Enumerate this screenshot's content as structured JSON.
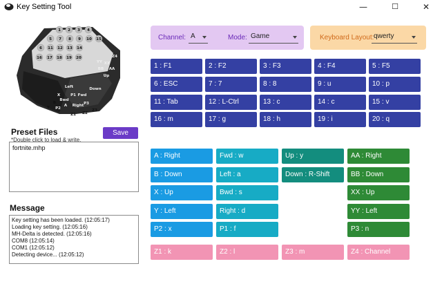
{
  "window": {
    "title": "Key Setting Tool",
    "minimize_glyph": "—",
    "maximize_glyph": "☐",
    "close_glyph": "✕"
  },
  "device": {
    "labels": [
      "1",
      "2",
      "3",
      "4",
      "5",
      "6",
      "7",
      "8",
      "9",
      "10",
      "11",
      "12",
      "13",
      "14",
      "15",
      "16",
      "17",
      "18",
      "19",
      "20",
      "Z4",
      "XX",
      "BB",
      "AA",
      "Up",
      "YY",
      "Left",
      "Down",
      "Fwd",
      "P1",
      "X",
      "Bwd",
      "A",
      "Right",
      "P2",
      "P3",
      "Y",
      "Z1",
      "Z2",
      "Z3",
      "B"
    ]
  },
  "preset": {
    "title": "Preset Files",
    "hint": "*Double click to load & write.",
    "save_label": "Save",
    "files": [
      "fortnite.mhp"
    ]
  },
  "message": {
    "title": "Message",
    "lines": [
      "Key setting has been loaded. (12:05:17)",
      "Loading key setting. (12:05:16)",
      "MH-Delta is detected. (12:05:16)",
      "COM8 (12:05:14)",
      "COM1 (12:05:12)",
      "Detecting device... (12:05:12)"
    ]
  },
  "controls": {
    "channel_label": "Channel:",
    "channel_value": "A",
    "mode_label": "Mode:",
    "mode_value": "Game",
    "layout_label": "Keyboard Layout:",
    "layout_value": "qwerty"
  },
  "numbered_keys": [
    "1 : F1",
    "2 : F2",
    "3 : F3",
    "4 : F4",
    "5 : F5",
    "6 : ESC",
    "7 : 7",
    "8 : 8",
    "9 : u",
    "10 : p",
    "11 : Tab",
    "12 : L-Ctrl",
    "13 : c",
    "14 : c",
    "15 : v",
    "16 : m",
    "17 : g",
    "18 : h",
    "19 : i",
    "20 : q"
  ],
  "col_blue": [
    "A : Right",
    "B : Down",
    "X : Up",
    "Y : Left",
    "P2 : x"
  ],
  "col_cyan": [
    "Fwd : w",
    "Left : a",
    "Bwd : s",
    "Right : d",
    "P1 : f"
  ],
  "col_teal": [
    "Up : y",
    "Down : R-Shift"
  ],
  "col_green": [
    "AA : Right",
    "BB : Down",
    "XX : Up",
    "YY : Left",
    "P3 : n"
  ],
  "z_keys": [
    "Z1 : k",
    "Z2 : l",
    "Z3 : m",
    "Z4 : Channel"
  ],
  "colors": {
    "navy": "#3440a3",
    "blue": "#1a9be3",
    "cyan": "#17abc5",
    "teal": "#138d7e",
    "green": "#2e8a36",
    "pink": "#f294b4",
    "purple": "#6b3bc7"
  }
}
